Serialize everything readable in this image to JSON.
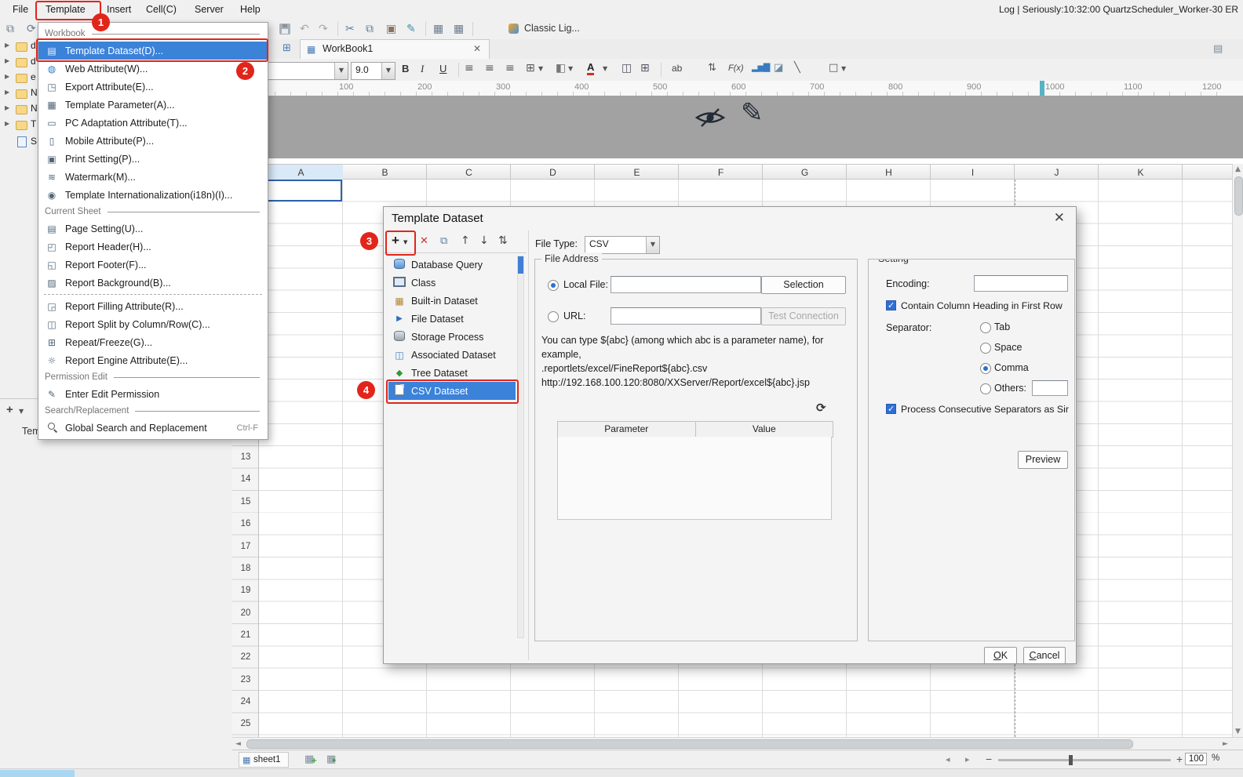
{
  "window": {
    "menubar_items": [
      "File",
      "Template",
      "Insert",
      "Cell(C)",
      "Server",
      "Help"
    ],
    "status_right": "Log | Seriously:10:32:00 QuartzScheduler_Worker-30 ER"
  },
  "toolbar": {
    "scheme_label": "Classic Lig..."
  },
  "tabbar": {
    "active_tab": "WorkBook1"
  },
  "format_toolbar": {
    "font_size": "9.0",
    "bold": "B",
    "italic": "I",
    "underline": "U",
    "font_color": "A",
    "wrap": "ab",
    "fx": "F(x)"
  },
  "ruler": {
    "marks": [
      "100",
      "200",
      "300",
      "400",
      "500",
      "600",
      "700",
      "800",
      "900",
      "1000",
      "1100",
      "1200"
    ]
  },
  "sheet": {
    "columns": [
      "A",
      "B",
      "C",
      "D",
      "E",
      "F",
      "G",
      "H",
      "I",
      "J",
      "K"
    ],
    "rows": [
      "13",
      "14",
      "15",
      "16",
      "17",
      "18",
      "19",
      "20",
      "21",
      "22",
      "23",
      "24",
      "25"
    ]
  },
  "left_panel": {
    "tree_fragments": [
      "d",
      "d",
      "e",
      "N",
      "N",
      "T",
      "S"
    ],
    "add": "+",
    "bottom_label": "Tem"
  },
  "template_menu": {
    "sections": [
      {
        "header": "Workbook"
      },
      {
        "header": "Current Sheet"
      },
      {
        "header": "Permission Edit"
      },
      {
        "header": "Search/Replacement"
      }
    ],
    "items": {
      "template_dataset": "Template Dataset(D)...",
      "web_attribute": "Web Attribute(W)...",
      "export_attribute": "Export Attribute(E)...",
      "template_parameter": "Template Parameter(A)...",
      "pc_adaptation": "PC Adaptation Attribute(T)...",
      "mobile_attribute": "Mobile Attribute(P)...",
      "print_setting": "Print Setting(P)...",
      "watermark": "Watermark(M)...",
      "i18n": "Template Internationalization(i18n)(I)...",
      "page_setting": "Page Setting(U)...",
      "report_header": "Report Header(H)...",
      "report_footer": "Report Footer(F)...",
      "report_background": "Report Background(B)...",
      "report_filling": "Report Filling Attribute(R)...",
      "report_split": "Report Split by Column/Row(C)...",
      "repeat_freeze": "Repeat/Freeze(G)...",
      "report_engine": "Report Engine Attribute(E)...",
      "enter_edit_permission": "Enter Edit Permission",
      "global_search": "Global Search and Replacement",
      "global_search_shortcut": "Ctrl-F"
    }
  },
  "dialog": {
    "title": "Template Dataset",
    "dataset_list": [
      "Database Query",
      "Class",
      "Built-in Dataset",
      "File Dataset",
      "Storage Process",
      "Associated Dataset",
      "Tree Dataset",
      "CSV Dataset"
    ],
    "file_type_label": "File Type:",
    "file_type_value": "CSV",
    "file_address": {
      "legend": "File Address",
      "local_file": "Local File:",
      "selection": "Selection",
      "url": "URL:",
      "test_connection": "Test Connection",
      "help1": "You can type ${abc} (among which abc is a parameter name), for",
      "help2": "example,",
      "help3": ".reportlets/excel/FineReport${abc}.csv",
      "help4": "http://192.168.100.120:8080/XXServer/Report/excel${abc}.jsp",
      "table_headers": [
        "Parameter",
        "Value"
      ]
    },
    "setting": {
      "legend": "Setting",
      "encoding": "Encoding:",
      "contain_heading": "Contain Column Heading in First Row",
      "separator": "Separator:",
      "tab": "Tab",
      "space": "Space",
      "comma": "Comma",
      "others": "Others:",
      "selected_separator": "Comma",
      "process_consecutive": "Process Consecutive Separators as Sir",
      "preview": "Preview"
    },
    "ok": "OK",
    "cancel": "Cancel"
  },
  "statusbar": {
    "sheet_tab": "sheet1",
    "zoom": "100",
    "percent": "%"
  },
  "annotations": {
    "step1": "1",
    "step2": "2",
    "step3": "3",
    "step4": "4"
  },
  "colors": {
    "annotation_red": "#e2251a",
    "selection_blue": "#3b82d9",
    "banner_gray": "#a2a2a2",
    "ruler_marker_teal": "#57b2c3"
  },
  "icons": {
    "close": "✕",
    "cut": "✂",
    "undo": "↶",
    "redo": "↷",
    "refresh": "⟳",
    "search": "magnifier-css",
    "hidden_eye": "eye-slash-svg",
    "edit_pencil": "✎",
    "dropdown": "▼"
  }
}
